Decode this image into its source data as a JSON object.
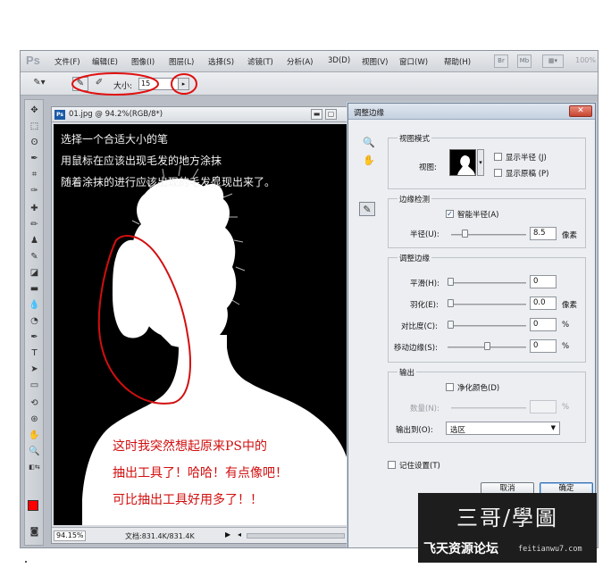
{
  "app": {
    "logo": "Ps",
    "menu": [
      "文件(F)",
      "编辑(E)",
      "图像(I)",
      "图层(L)",
      "选择(S)",
      "滤镜(T)",
      "分析(A)",
      "3D(D)",
      "视图(V)",
      "窗口(W)",
      "帮助(H)"
    ],
    "menu_buttons": [
      "Br",
      "Mb"
    ],
    "zoom_readout": "100%"
  },
  "options_bar": {
    "size_label": "大小:",
    "size_value": "15"
  },
  "document": {
    "title": "01.jpg @ 94.2%(RGB/8*)",
    "zoom": "94.15%",
    "doc_info": "文档:831.4K/831.4K",
    "instructions": [
      "选择一个合适大小的笔",
      "用鼠标在应该出现毛发的地方涂抹",
      "随着涂抹的进行应该出现的毛发显现出来了。"
    ],
    "annotation": [
      "这时我突然想起原来PS中的",
      "抽出工具了！哈哈！有点像吧！",
      "可比抽出工具好用多了！！"
    ]
  },
  "dialog": {
    "title": "调整边缘",
    "view_mode": {
      "group_title": "视图模式",
      "view_label": "视图:",
      "show_radius": "显示半径 (J)",
      "show_original": "显示原稿 (P)"
    },
    "edge_detection": {
      "group_title": "边缘检测",
      "smart_radius": "智能半径(A)",
      "smart_radius_checked": true,
      "radius_label": "半径(U):",
      "radius_value": "8.5",
      "radius_unit": "像素",
      "radius_fraction": 0.18
    },
    "adjust_edge": {
      "group_title": "调整边缘",
      "smooth_label": "平滑(H):",
      "smooth_value": "0",
      "feather_label": "羽化(E):",
      "feather_value": "0.0",
      "feather_unit": "像素",
      "contrast_label": "对比度(C):",
      "contrast_value": "0",
      "contrast_unit": "%",
      "shift_label": "移动边缘(S):",
      "shift_value": "0",
      "shift_unit": "%",
      "shift_fraction": 0.5
    },
    "output": {
      "group_title": "输出",
      "decontaminate": "净化颜色(D)",
      "amount_label": "数量(N):",
      "amount_unit": "%",
      "output_to_label": "输出到(O):",
      "output_to_value": "选区"
    },
    "remember": "记住设置(T)",
    "cancel": "取消",
    "ok": "确定"
  },
  "watermark": {
    "logo": "三哥/學圖",
    "site": "飞天资源论坛",
    "url": "feitianwu7.com"
  },
  "colors": {
    "annotation_red": "#d20f0f",
    "foreground": "#ff0000",
    "background": "#ffffff"
  }
}
